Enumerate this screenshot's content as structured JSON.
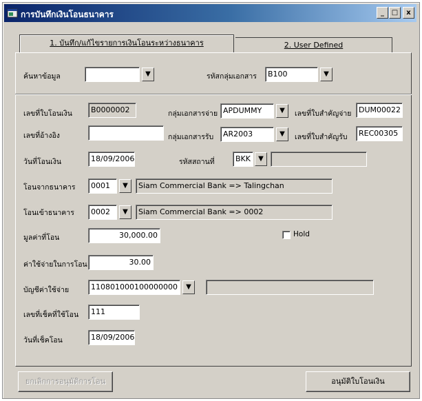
{
  "window": {
    "title": "การบันทึกเงินโอนธนาคาร",
    "minimize": "_",
    "maximize": "□",
    "close": "x"
  },
  "tabs": [
    {
      "label": "1. บันทึก/แก้ไขรายการเงินโอนระหว่างธนาคาร",
      "active": true
    },
    {
      "label": "2. User Defined",
      "active": false
    }
  ],
  "search": {
    "keyword_label": "ค้นหาข้อมูล",
    "keyword_value": "",
    "doc_group_label": "รหัสกลุ่มเอกสาร",
    "doc_group_value": "B100"
  },
  "form": {
    "doc_no_label": "เลขที่ใบโอนเงิน",
    "doc_no_value": "B0000002",
    "ref_no_label": "เลขที่อ้างอิง",
    "ref_no_value": "",
    "transfer_date_label": "วันที่โอนเงิน",
    "transfer_date_value": "18/09/2006",
    "from_bank_label": "โอนจากธนาคาร",
    "from_bank_code": "0001",
    "from_bank_name": "Siam Commercial Bank => Talingchan",
    "to_bank_label": "โอนเข้าธนาคาร",
    "to_bank_code": "0002",
    "to_bank_name": "Siam Commercial Bank => 0002",
    "amount_label": "มูลค่าที่โอน",
    "amount_value": "30,000.00",
    "fee_label": "ค่าใช้จ่ายในการโอน",
    "fee_value": "30.00",
    "expense_account_label": "บัญชีค่าใช้จ่าย",
    "expense_account_value": "110801000100000000",
    "expense_account_desc": "",
    "cheque_no_label": "เลขที่เช็คที่ใช้โอน",
    "cheque_no_value": "111",
    "cheque_date_label": "วันที่เช็คโอน",
    "cheque_date_value": "18/09/2006",
    "pay_group_label": "กลุ่มเอกสารจ่าย",
    "pay_group_value": "APDUMMY",
    "pay_doc_label": "เลขที่ใบสำคัญจ่าย",
    "pay_doc_value": "DUM00022",
    "recv_group_label": "กลุ่มเอกสารรับ",
    "recv_group_value": "AR2003",
    "recv_doc_label": "เลขที่ใบสำคัญรับ",
    "recv_doc_value": "REC00305",
    "branch_label": "รหัสสถานที่",
    "branch_value": "BKK",
    "branch_desc": "",
    "hold_label": "Hold",
    "hold_checked": false
  },
  "buttons": {
    "cancel_approve": "ยกเลิกการอนุมัติการโอน",
    "approve": "อนุมัติใบโอนเงิน"
  },
  "icons": {
    "dropdown": "▼",
    "app": "app-window-icon"
  }
}
